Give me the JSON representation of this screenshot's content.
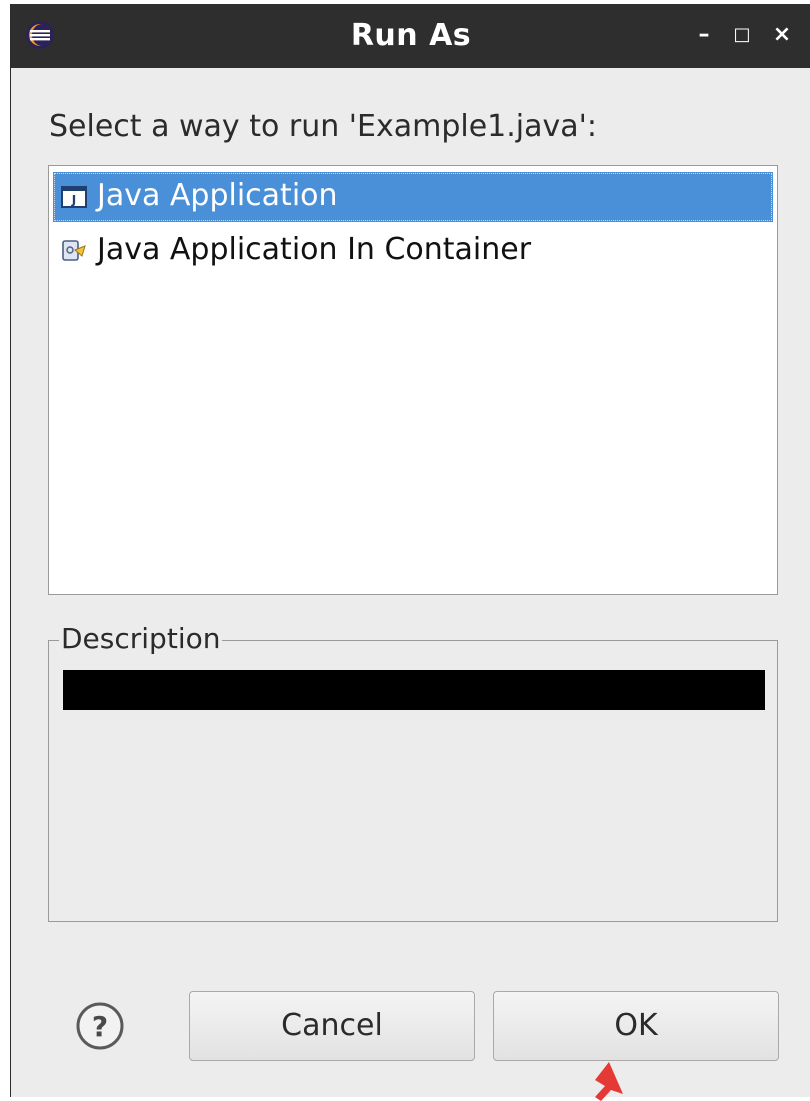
{
  "window": {
    "title": "Run As",
    "controls": {
      "minimize": "–",
      "maximize": "□",
      "close": "×"
    }
  },
  "prompt": "Select a way to run 'Example1.java':",
  "launch_options": [
    {
      "label": "Java Application",
      "icon": "java-app-icon",
      "selected": true
    },
    {
      "label": "Java Application In Container",
      "icon": "container-app-icon",
      "selected": false
    }
  ],
  "description": {
    "group_label": "Description"
  },
  "buttons": {
    "help_icon": "?",
    "cancel": "Cancel",
    "ok": "OK"
  },
  "colors": {
    "titlebar": "#2e2e2e",
    "selection": "#4a90d9",
    "dialog_bg": "#ececec",
    "annotation_arrow": "#e53935"
  }
}
